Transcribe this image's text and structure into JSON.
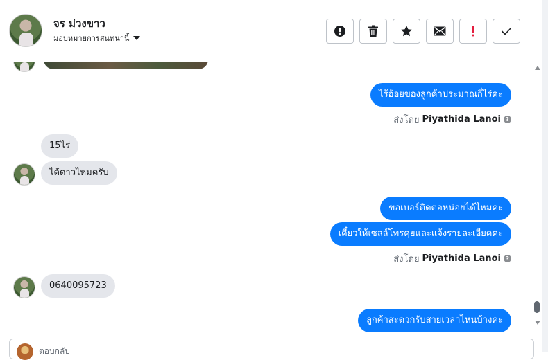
{
  "header": {
    "contact_name": "จร ม่วงขาว",
    "assign_label": "มอบหมายการสนทนานี้"
  },
  "toolbar": [
    {
      "name": "spam-button",
      "icon": "exclamation-circle-icon"
    },
    {
      "name": "delete-button",
      "icon": "trash-icon"
    },
    {
      "name": "star-button",
      "icon": "star-icon"
    },
    {
      "name": "mark-unread-button",
      "icon": "envelope-icon"
    },
    {
      "name": "follow-up-button",
      "icon": "exclamation-icon",
      "color": "#e41e3f"
    },
    {
      "name": "mark-done-button",
      "icon": "checkmark-icon"
    }
  ],
  "messages": {
    "m1": "ไร้อ้อยของลูกค้าประมาณกี่ไร่คะ",
    "sent1_prefix": "ส่งโดย",
    "sent1_agent": "Piyathida Lanoi",
    "m2": "15ไร่",
    "m3": "ได้ดาวไหมครับ",
    "m4": "ขอเบอร์ติดต่อหน่อยได้ไหมคะ",
    "m5": "เดี๋ยวให้เซลล์โทรคุยและแจ้งรายละเอียดค่ะ",
    "sent2_prefix": "ส่งโดย",
    "sent2_agent": "Piyathida Lanoi",
    "m6": "0640095723",
    "m7": "ลูกค้าสะดวกรับสายเวลาไหนบ้างคะ"
  },
  "composer": {
    "placeholder": "ตอบกลับ"
  },
  "colors": {
    "outgoing_bubble": "#0a7cff",
    "incoming_bubble": "#e4e6eb",
    "follow_up": "#e41e3f"
  }
}
